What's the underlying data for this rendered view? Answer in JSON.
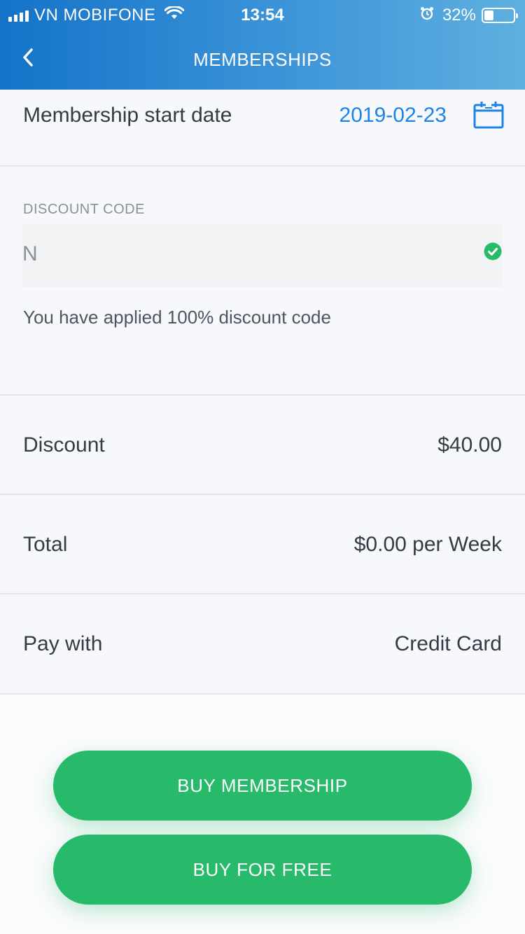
{
  "status_bar": {
    "carrier": "VN MOBIFONE",
    "time": "13:54",
    "battery": "32%",
    "battery_level": 0.32
  },
  "nav": {
    "title": "MEMBERSHIPS"
  },
  "start_date": {
    "label": "Membership start date",
    "value": "2019-02-23"
  },
  "discount_code": {
    "label": "DISCOUNT CODE",
    "value": "N",
    "message": "You have applied 100% discount code"
  },
  "summary": {
    "discount_label": "Discount",
    "discount_value": "$40.00",
    "total_label": "Total",
    "total_value": "$0.00 per Week",
    "pay_label": "Pay with",
    "pay_value": "Credit Card"
  },
  "buttons": {
    "buy_membership": "BUY MEMBERSHIP",
    "buy_free": "BUY FOR FREE"
  },
  "colors": {
    "accent_blue": "#1d84e6",
    "button_green": "#27ba6b",
    "header_gradient_start": "#1473c9",
    "header_gradient_end": "#5fb0e0"
  }
}
